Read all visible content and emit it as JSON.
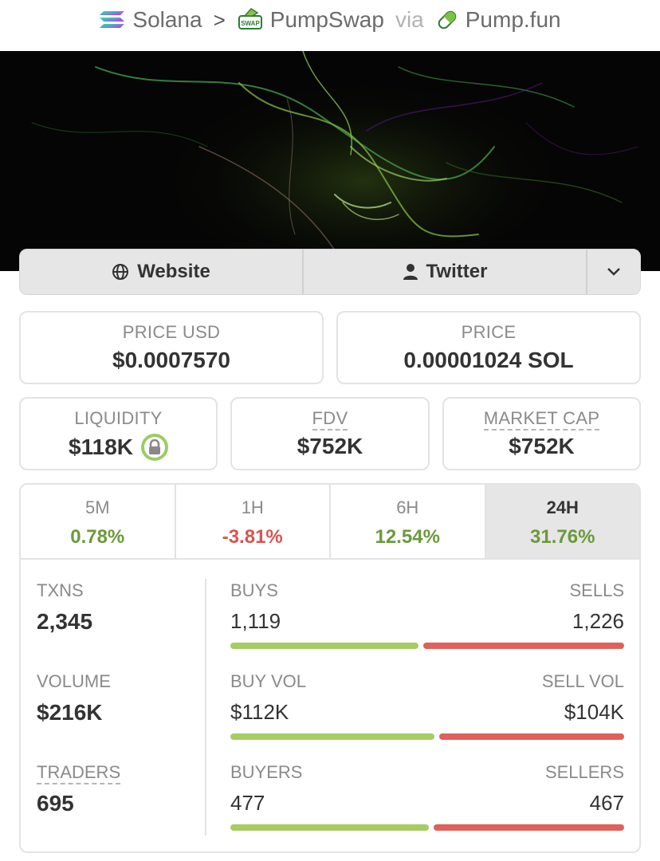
{
  "breadcrumb": {
    "chain": "Solana",
    "dex": "PumpSwap",
    "via": "via",
    "launchpad": "Pump.fun"
  },
  "links": {
    "website": "Website",
    "twitter": "Twitter"
  },
  "price_usd": {
    "label": "PRICE USD",
    "value": "$0.0007570"
  },
  "price": {
    "label": "PRICE",
    "value": "0.00001024 SOL"
  },
  "liquidity": {
    "label": "LIQUIDITY",
    "value": "$118K"
  },
  "fdv": {
    "label": "FDV",
    "value": "$752K"
  },
  "market_cap": {
    "label": "MARKET CAP",
    "value": "$752K"
  },
  "tabs": [
    {
      "label": "5M",
      "change": "0.78%"
    },
    {
      "label": "1H",
      "change": "-3.81%"
    },
    {
      "label": "6H",
      "change": "12.54%"
    },
    {
      "label": "24H",
      "change": "31.76%"
    }
  ],
  "metrics": {
    "txns": {
      "label": "TXNS",
      "value": "2,345"
    },
    "volume": {
      "label": "VOLUME",
      "value": "$216K"
    },
    "traders": {
      "label": "TRADERS",
      "value": "695"
    }
  },
  "splits": {
    "buys": {
      "left_label": "BUYS",
      "right_label": "SELLS",
      "left_value": "1,119",
      "right_value": "1,226",
      "buy_fraction": 0.477
    },
    "volume": {
      "left_label": "BUY VOL",
      "right_label": "SELL VOL",
      "left_value": "$112K",
      "right_value": "$104K",
      "buy_fraction": 0.519
    },
    "traders": {
      "left_label": "BUYERS",
      "right_label": "SELLERS",
      "left_value": "477",
      "right_value": "467",
      "buy_fraction": 0.505
    }
  },
  "colors": {
    "positive": "#6a9a3a",
    "negative": "#d9534f",
    "buy_bar": "#a6cc63",
    "sell_bar": "#e0605a",
    "lock_ring": "#9ccc65"
  }
}
